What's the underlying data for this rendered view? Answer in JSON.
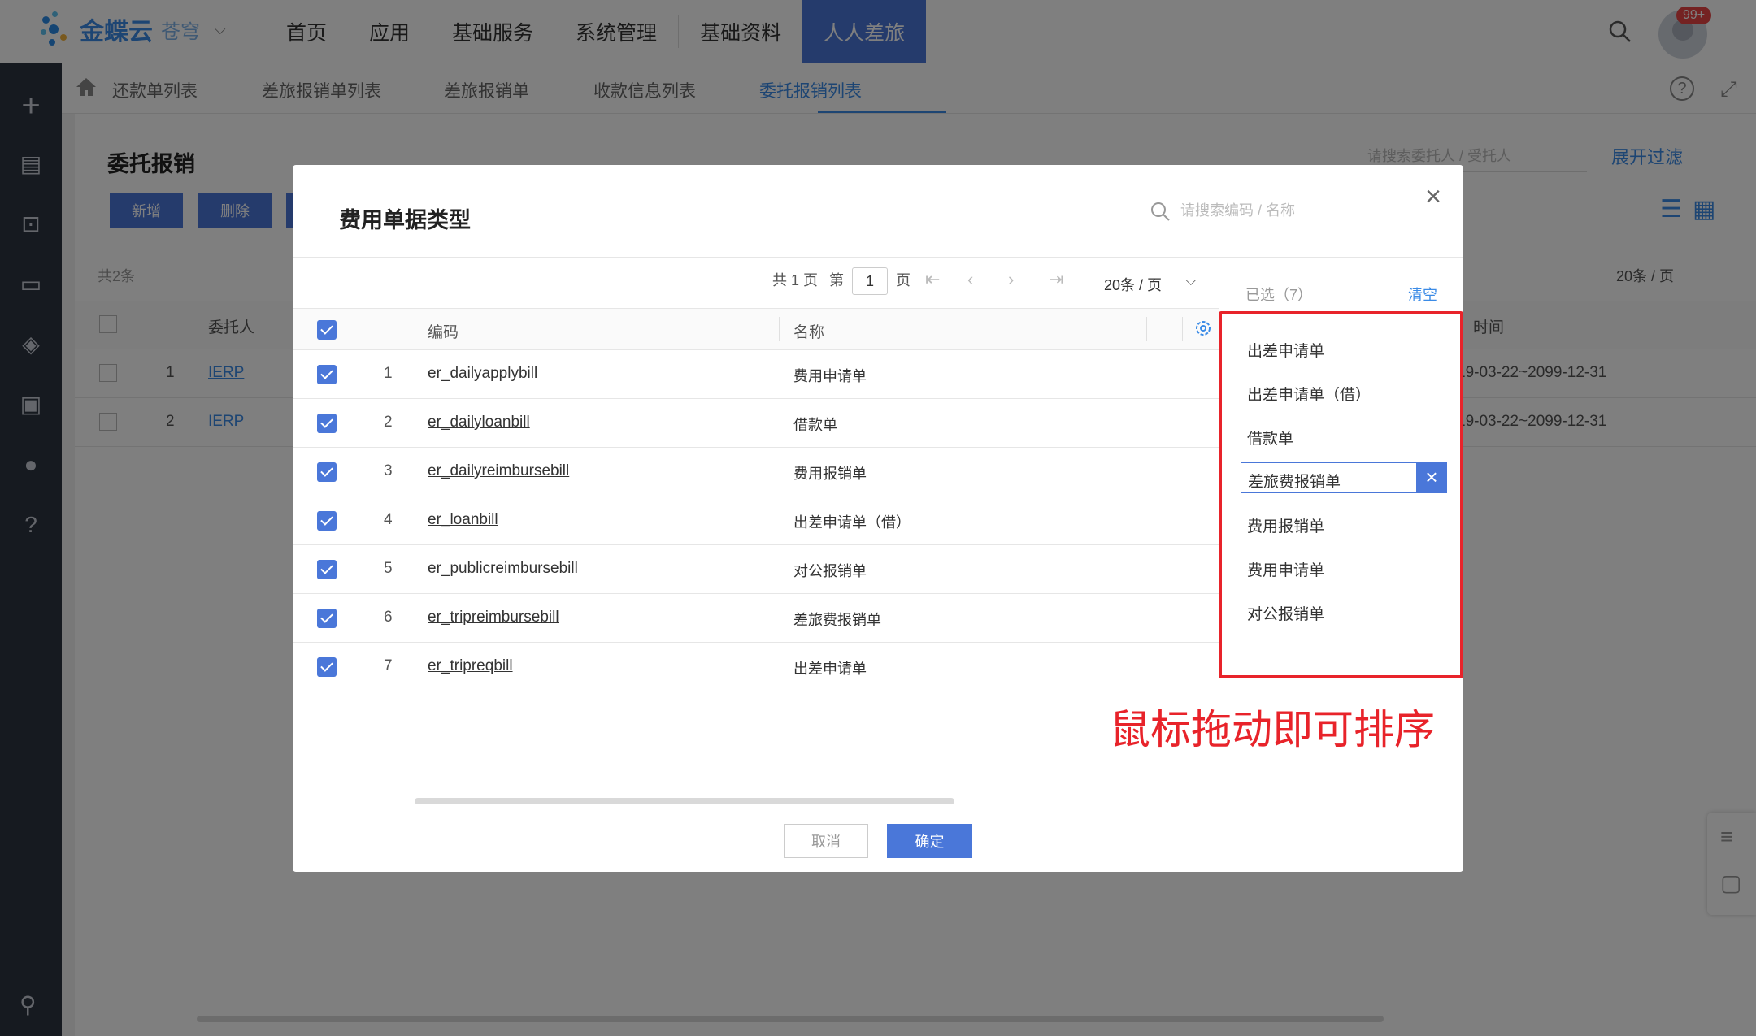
{
  "brand": {
    "logo_text": "金蝶云",
    "logo_sub": "苍穹"
  },
  "nav": [
    "首页",
    "应用",
    "基础服务",
    "系统管理",
    "基础资料",
    "人人差旅"
  ],
  "notifications": "99+",
  "subtabs": [
    "还款单列表",
    "差旅报销单列表",
    "差旅报销单",
    "收款信息列表",
    "委托报销列表"
  ],
  "page": {
    "title": "委托报销",
    "buttons": [
      "新增",
      "删除"
    ],
    "search_placeholder": "请搜索委托人 / 受托人",
    "expand_filter": "展开过滤",
    "total": "共2条",
    "page_size": "20条 / 页",
    "col_delegator": "委托人",
    "col_time_partial": "时间",
    "rows": [
      {
        "idx": "1",
        "delegator": "IERP",
        "period": "19-03-22~2099-12-31"
      },
      {
        "idx": "2",
        "delegator": "IERP",
        "period": "19-03-22~2099-12-31"
      }
    ]
  },
  "modal": {
    "title": "费用单据类型",
    "search_placeholder": "请搜索编码 / 名称",
    "pager": {
      "total_pages": "共 1 页",
      "page_prefix": "第",
      "page_value": "1",
      "page_suffix": "页",
      "page_size": "20条 / 页"
    },
    "columns": {
      "code": "编码",
      "name": "名称"
    },
    "rows": [
      {
        "idx": "1",
        "code": "er_dailyapplybill",
        "name": "费用申请单"
      },
      {
        "idx": "2",
        "code": "er_dailyloanbill",
        "name": "借款单"
      },
      {
        "idx": "3",
        "code": "er_dailyreimbursebill",
        "name": "费用报销单"
      },
      {
        "idx": "4",
        "code": "er_loanbill",
        "name": "出差申请单（借）"
      },
      {
        "idx": "5",
        "code": "er_publicreimbursebill",
        "name": "对公报销单"
      },
      {
        "idx": "6",
        "code": "er_tripreimbursebill",
        "name": "差旅费报销单"
      },
      {
        "idx": "7",
        "code": "er_tripreqbill",
        "name": "出差申请单"
      }
    ],
    "selected": {
      "count_label": "已选（7）",
      "clear": "清空",
      "items": [
        "出差申请单",
        "出差申请单（借）",
        "借款单",
        "差旅费报销单",
        "费用报销单",
        "费用申请单",
        "对公报销单"
      ]
    },
    "drag_hint": "鼠标拖动即可排序",
    "cancel": "取消",
    "confirm": "确定"
  },
  "colors": {
    "primary": "#4a77d9",
    "link": "#3b8be6",
    "sidebar": "#2d3441",
    "highlight": "#e8232a"
  }
}
